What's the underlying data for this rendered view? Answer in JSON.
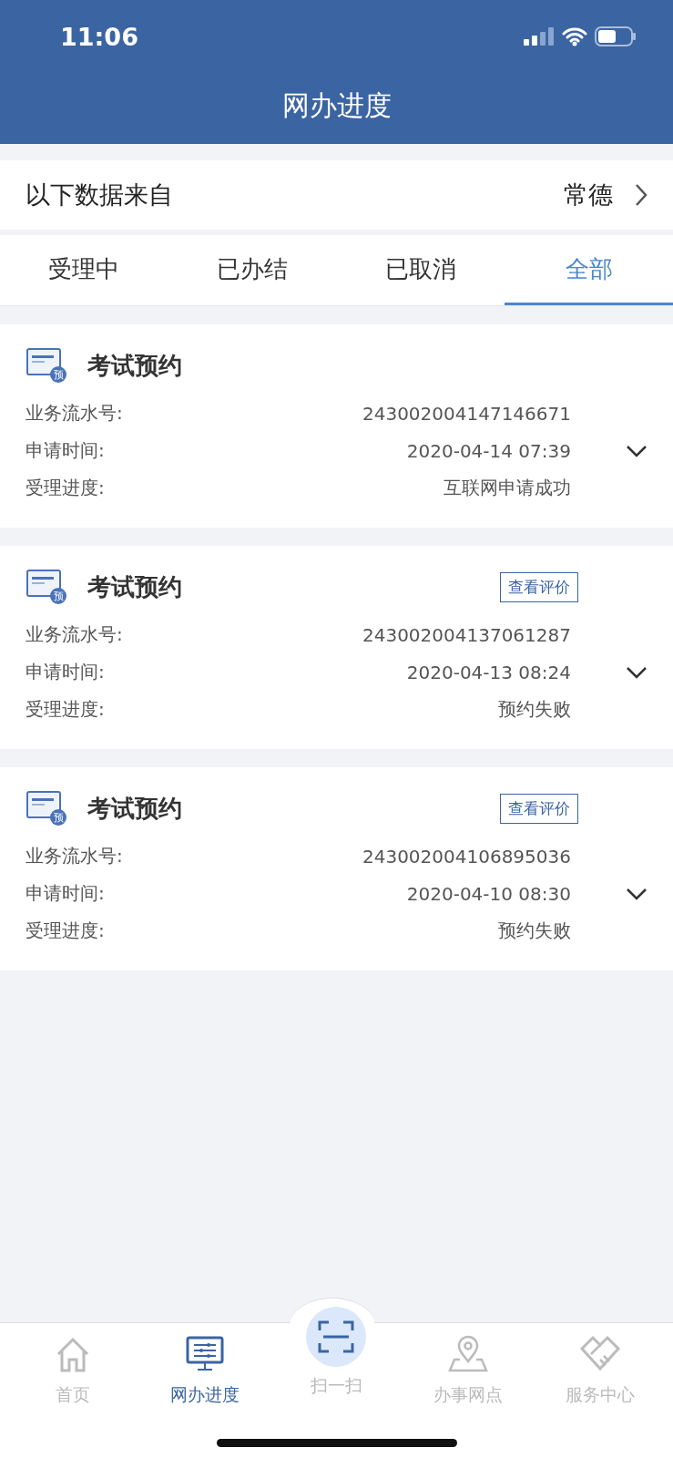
{
  "status_bar": {
    "time": "11:06"
  },
  "header": {
    "title": "网办进度"
  },
  "region": {
    "label": "以下数据来自",
    "value": "常德"
  },
  "tabs": [
    {
      "label": "受理中",
      "selected": false
    },
    {
      "label": "已办结",
      "selected": false
    },
    {
      "label": "已取消",
      "selected": false
    },
    {
      "label": "全部",
      "selected": true
    }
  ],
  "records": [
    {
      "title": "考试预约",
      "icon_badge": "预",
      "fields": [
        {
          "label": "业务流水号:",
          "value": "243002004147146671"
        },
        {
          "label": "申请时间:",
          "value": "2020-04-14 07:39"
        },
        {
          "label": "受理进度:",
          "value": "互联网申请成功"
        }
      ]
    },
    {
      "title": "考试预约",
      "icon_badge": "预",
      "action": "查看评价",
      "fields": [
        {
          "label": "业务流水号:",
          "value": "243002004137061287"
        },
        {
          "label": "申请时间:",
          "value": "2020-04-13 08:24"
        },
        {
          "label": "受理进度:",
          "value": "预约失败"
        }
      ]
    },
    {
      "title": "考试预约",
      "icon_badge": "预",
      "action": "查看评价",
      "fields": [
        {
          "label": "业务流水号:",
          "value": "243002004106895036"
        },
        {
          "label": "申请时间:",
          "value": "2020-04-10 08:30"
        },
        {
          "label": "受理进度:",
          "value": "预约失败"
        }
      ]
    }
  ],
  "tab_bar": [
    {
      "kind": "home",
      "label": "首页",
      "selected": false
    },
    {
      "kind": "monitor",
      "label": "网办进度",
      "selected": true
    },
    {
      "kind": "scan",
      "label": "扫一扫",
      "selected": false
    },
    {
      "kind": "pin",
      "label": "办事网点",
      "selected": false
    },
    {
      "kind": "handshake",
      "label": "服务中心",
      "selected": false
    }
  ]
}
